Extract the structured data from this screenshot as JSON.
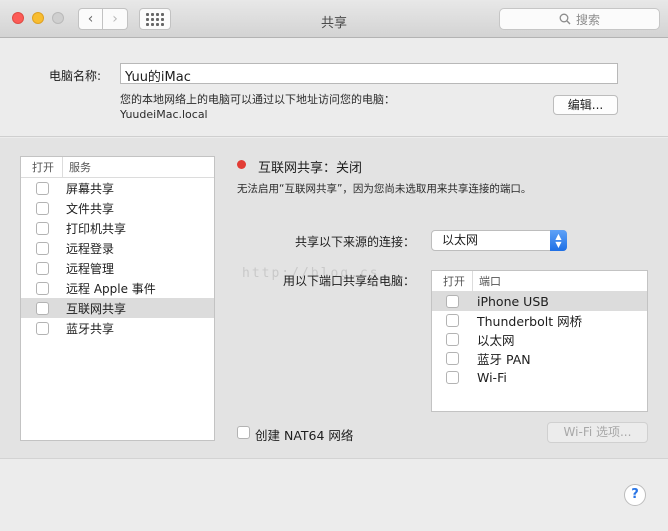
{
  "window": {
    "title": "共享",
    "search_placeholder": "搜索"
  },
  "computer": {
    "name_label": "电脑名称:",
    "name_value": "Yuu的iMac",
    "address_desc": "您的本地网络上的电脑可以通过以下地址访问您的电脑：",
    "address": "YuudeiMac.local",
    "edit_button": "编辑..."
  },
  "services": {
    "col_on": "打开",
    "col_service": "服务",
    "items": [
      {
        "label": "屏幕共享",
        "checked": false
      },
      {
        "label": "文件共享",
        "checked": false
      },
      {
        "label": "打印机共享",
        "checked": false
      },
      {
        "label": "远程登录",
        "checked": false
      },
      {
        "label": "远程管理",
        "checked": false
      },
      {
        "label": "远程 Apple 事件",
        "checked": false
      },
      {
        "label": "互联网共享",
        "checked": false,
        "selected": true
      },
      {
        "label": "蓝牙共享",
        "checked": false
      }
    ]
  },
  "detail": {
    "status": "互联网共享：关闭",
    "status_color": "#e23c35",
    "status_desc": "无法启用“互联网共享”，因为您尚未选取用来共享连接的端口。",
    "share_from_label": "共享以下来源的连接：",
    "share_from_value": "以太网",
    "watermark": "http://blog.cs",
    "share_to_label": "用以下端口共享给电脑：",
    "port_col_on": "打开",
    "port_col_port": "端口",
    "ports": [
      {
        "label": "iPhone USB",
        "checked": false,
        "selected": true
      },
      {
        "label": "Thunderbolt 网桥",
        "checked": false
      },
      {
        "label": "以太网",
        "checked": false
      },
      {
        "label": "蓝牙 PAN",
        "checked": false
      },
      {
        "label": "Wi-Fi",
        "checked": false
      }
    ],
    "nat64_label": "创建 NAT64 网络",
    "wifi_options_button": "Wi-Fi 选项..."
  },
  "help": {
    "label": "?"
  }
}
